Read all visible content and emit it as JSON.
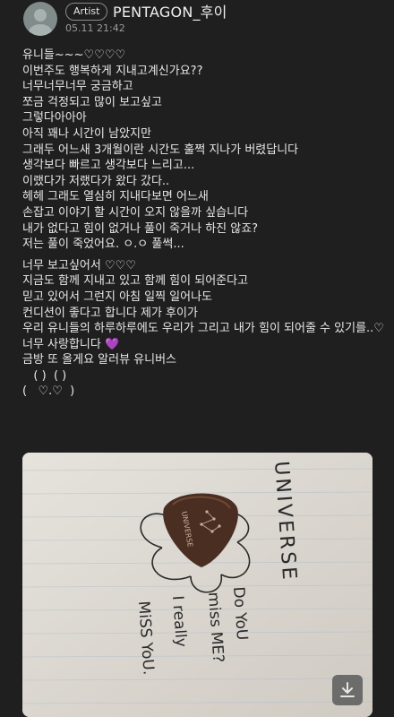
{
  "header": {
    "badge": "Artist",
    "author": "PENTAGON_후이",
    "timestamp": "05.11 21:42"
  },
  "post": {
    "lines": [
      "유니들~~~♡♡♡♡",
      "이번주도 행복하게 지내고계신가요??",
      "너무너무너무 궁금하고",
      "쪼금 걱정되고 많이 보고싶고",
      "그렇다아아아",
      "아직 꽤나 시간이 남았지만",
      "그래두 어느새 3개월이란 시간도 훌쩍 지나가 버렸답니다",
      "생각보다 빠르고 생각보다 느리고...",
      "이랬다가 저랬다가 왔다 갔다..",
      "헤헤  그래도 열심히 지내다보면 어느새",
      "손잡고 이야기 할 시간이 오지 않을까 싶습니다",
      "내가 없다고 힘이 없거나 풀이 죽거나 하진 않죠?",
      "저는 풀이 죽었어요. ㅇ.ㅇ 풀썩...",
      "너무 보고싶어서 ♡♡♡",
      "지금도 함께 지내고 있고 함께 힘이 되어준다고",
      "믿고 있어서 그런지 아침 일찍 일어나도",
      "컨디션이 좋다고 합니다 제가 후이가",
      "우리 유니들의 하루하루에도 우리가 그리고 내가 힘이 되어줄 수 있기를..♡",
      "너무 사랑합니다",
      "금방 또 올게요 알러뷰 유니버스",
      "   ( )  ( )",
      "(   ♡.♡  )"
    ],
    "heart_emoji": "💜"
  },
  "photo": {
    "pick_text": "UNIVERSE",
    "handwriting": [
      "UNIVERSE",
      "Do YoU",
      "miss ME?",
      "I really",
      "MiSS YoU."
    ]
  },
  "colors": {
    "background": "#1f1f1f",
    "text": "#e8e8e8",
    "muted": "#9a9a9a",
    "heart": "#b86bff",
    "pick": "#5a3a2a"
  },
  "icons": {
    "avatar": "default-avatar-icon",
    "download": "download-icon"
  }
}
